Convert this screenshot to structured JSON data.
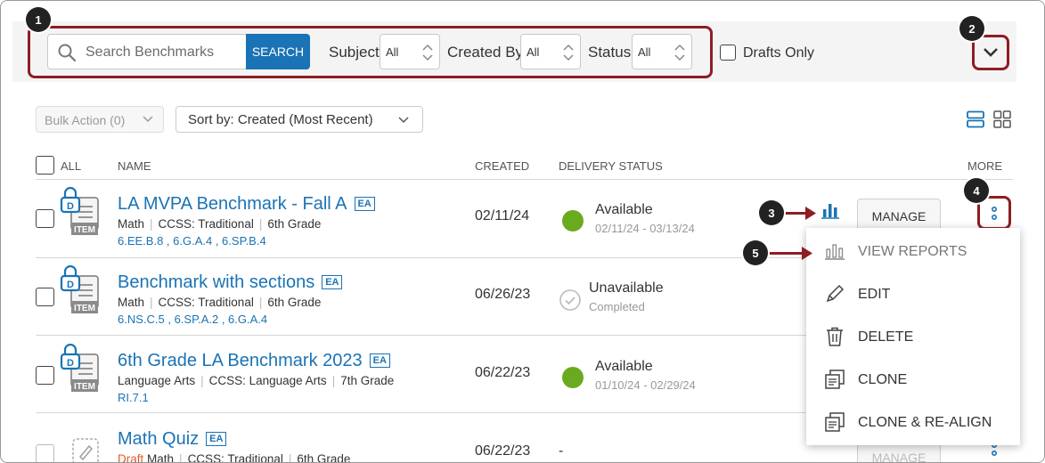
{
  "filters": {
    "search_placeholder": "Search Benchmarks",
    "search_button": "SEARCH",
    "subject_label": "Subject",
    "subject_value": "All",
    "created_by_label": "Created By",
    "created_by_value": "All",
    "status_label": "Status",
    "status_value": "All",
    "drafts_only_label": "Drafts Only"
  },
  "toolbar": {
    "bulk_action": "Bulk Action (0)",
    "sort_prefix": "Sort by:",
    "sort_value": "Created (Most Recent)"
  },
  "columns": {
    "all": "ALL",
    "name": "NAME",
    "created": "CREATED",
    "delivery_status": "DELIVERY STATUS",
    "more": "MORE"
  },
  "rows": [
    {
      "title": "LA MVPA Benchmark - Fall A",
      "badge": "EA",
      "meta": [
        "Math",
        "CCSS: Traditional",
        "6th Grade"
      ],
      "standards": "6.EE.B.8 , 6.G.A.4 , 6.SP.B.4",
      "created": "02/11/24",
      "status": "Available",
      "status_sub": "02/11/24 - 03/13/24",
      "manage": "MANAGE",
      "icon_text": "ITEM",
      "lock_text": "D"
    },
    {
      "title": "Benchmark with sections",
      "badge": "EA",
      "meta": [
        "Math",
        "CCSS: Traditional",
        "6th Grade"
      ],
      "standards": "6.NS.C.5 , 6.SP.A.2 , 6.G.A.4",
      "created": "06/26/23",
      "status": "Unavailable",
      "status_sub": "Completed",
      "icon_text": "ITEM",
      "lock_text": "D"
    },
    {
      "title": "6th Grade LA Benchmark 2023",
      "badge": "EA",
      "meta": [
        "Language Arts",
        "CCSS: Language Arts",
        "7th Grade"
      ],
      "standards": "RI.7.1",
      "created": "06/22/23",
      "status": "Available",
      "status_sub": "01/10/24 - 02/29/24",
      "icon_text": "ITEM",
      "lock_text": "D"
    },
    {
      "title": "Math Quiz",
      "badge": "EA",
      "draft": "Draft",
      "meta": [
        "Math",
        "CCSS: Traditional",
        "6th Grade"
      ],
      "created": "06/22/23",
      "status": "-",
      "manage": "MANAGE"
    }
  ],
  "menu": {
    "items": [
      "VIEW REPORTS",
      "EDIT",
      "DELETE",
      "CLONE",
      "CLONE & RE-ALIGN"
    ]
  },
  "callouts": [
    "1",
    "2",
    "3",
    "4",
    "5"
  ],
  "colors": {
    "accent": "#1a73b5",
    "highlight": "#8d1e23",
    "available": "#6aaa1f"
  }
}
